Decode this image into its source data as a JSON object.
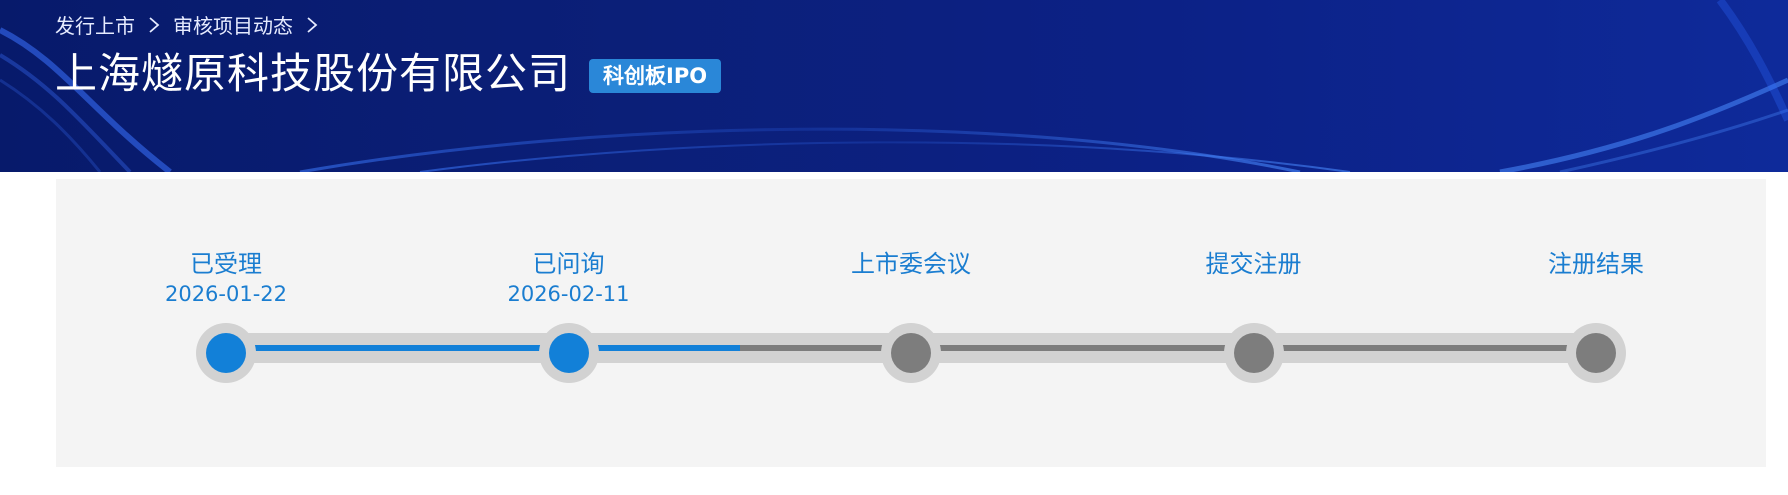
{
  "breadcrumb": [
    {
      "label": "发行上市"
    },
    {
      "label": "审核项目动态"
    }
  ],
  "header": {
    "company_name": "上海燧原科技股份有限公司",
    "board_badge": "科创板IPO"
  },
  "colors": {
    "banner_bg": "#0b1f78",
    "accent": "#1280d8",
    "pending": "#7d7d7d",
    "track": "#d2d2d2",
    "badge": "#2a87d8"
  },
  "progress": {
    "completed_fraction": 0.375,
    "steps": [
      {
        "label": "已受理",
        "date": "2026-01-22",
        "status": "done"
      },
      {
        "label": "已问询",
        "date": "2026-02-11",
        "status": "done"
      },
      {
        "label": "上市委会议",
        "date": "",
        "status": "pending"
      },
      {
        "label": "提交注册",
        "date": "",
        "status": "pending"
      },
      {
        "label": "注册结果",
        "date": "",
        "status": "pending"
      }
    ]
  },
  "icons": {
    "breadcrumb_separator": "chevron-right-icon"
  }
}
